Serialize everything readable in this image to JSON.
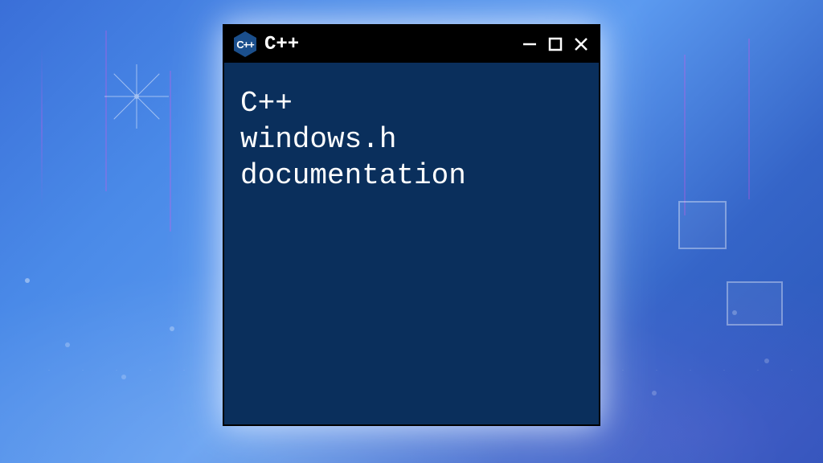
{
  "window": {
    "title": "C++",
    "icon_label": "C++",
    "controls": {
      "minimize": "minimize",
      "maximize": "maximize",
      "close": "close"
    }
  },
  "terminal": {
    "lines": [
      "C++",
      "windows.h",
      "documentation"
    ]
  }
}
